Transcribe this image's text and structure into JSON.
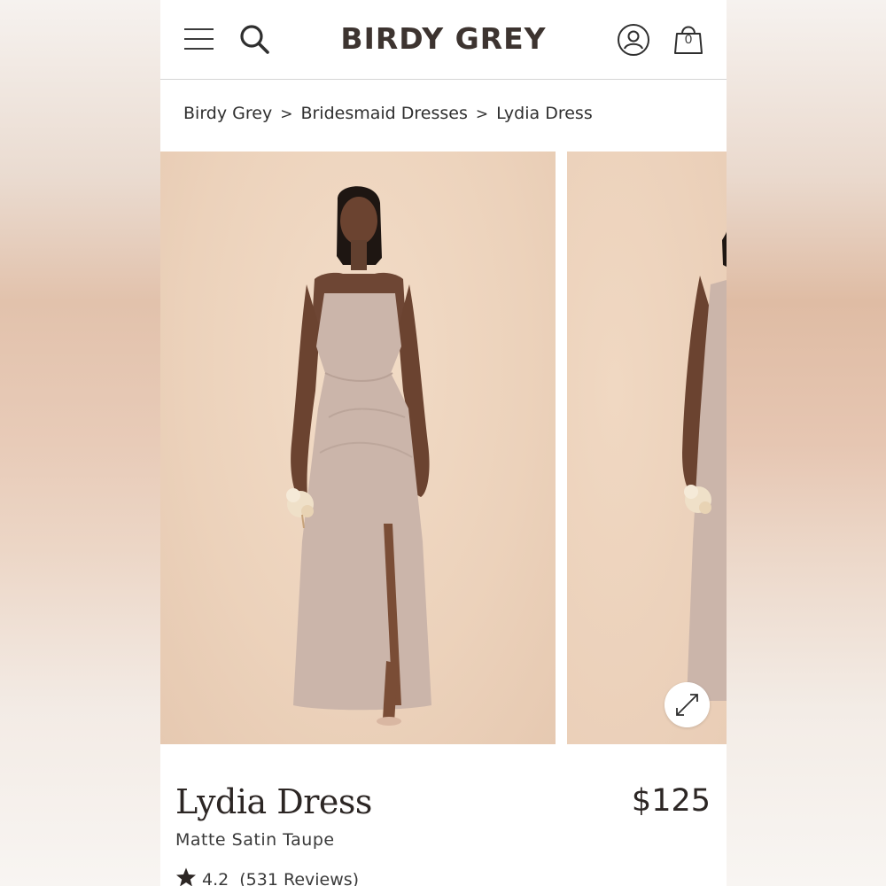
{
  "header": {
    "brand": "BIRDY GREY",
    "cart_count": "0",
    "icons": [
      "menu-icon",
      "search-icon",
      "account-icon",
      "shopping-bag-icon"
    ]
  },
  "breadcrumb": {
    "items": [
      "Birdy Grey",
      "Bridesmaid Dresses",
      "Lydia Dress"
    ],
    "separator": ">"
  },
  "gallery": {
    "expand_icon": "expand-icon",
    "backdrop_color": "#ecd3bc",
    "dress_color": "#c9b4a8"
  },
  "product": {
    "title": "Lydia Dress",
    "price": "$125",
    "color": "Matte Satin Taupe",
    "rating": "4.2",
    "reviews": "(531 Reviews)"
  }
}
